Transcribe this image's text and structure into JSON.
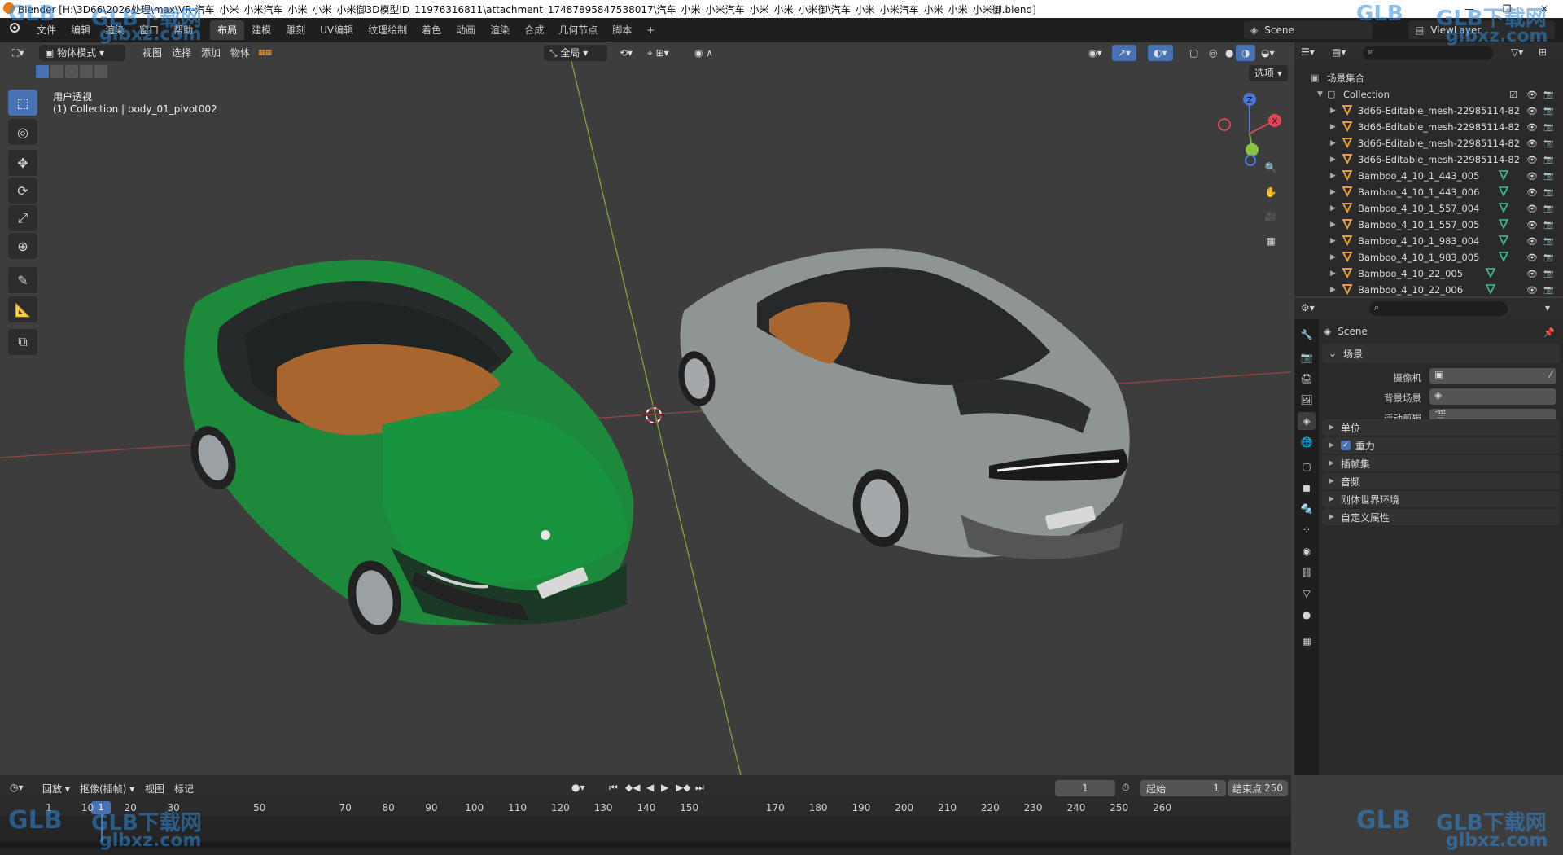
{
  "window": {
    "title": "Blender [H:\\3D66\\2026处理\\max\\VR-汽车_小米_小米汽车_小米_小米_小米御3D模型ID_11976316811\\attachment_17487895847538017\\汽车_小米_小米汽车_小米_小米_小米御\\汽车_小米_小米汽车_小米_小米_小米御.blend]",
    "controls": [
      "—",
      "❐",
      "✕"
    ]
  },
  "menubar": {
    "menus": [
      "文件",
      "编辑",
      "渲染",
      "窗口",
      "帮助"
    ],
    "tabs": [
      "布局",
      "建模",
      "雕刻",
      "UV编辑",
      "纹理绘制",
      "着色",
      "动画",
      "渲染",
      "合成",
      "几何节点",
      "脚本"
    ],
    "active_tab": "布局",
    "add_tab": "+",
    "scene": "Scene",
    "view_layer": "ViewLayer"
  },
  "viewport": {
    "mode": "物体模式",
    "menus": [
      "视图",
      "选择",
      "添加",
      "物体"
    ],
    "transform_orientation": "全局",
    "options": "选项",
    "overlay_title": "用户透视",
    "overlay_sub": "(1) Collection | body_01_pivot002",
    "gizmo_axes": [
      "Z",
      "X"
    ],
    "tools": [
      "select-box",
      "cursor",
      "move",
      "rotate",
      "scale",
      "transform",
      "annotate",
      "measure",
      "add-cube"
    ]
  },
  "outliner": {
    "root": "场景集合",
    "collection": "Collection",
    "items": [
      {
        "name": "3d66-Editable_mesh-22985114-82",
        "extra": false
      },
      {
        "name": "3d66-Editable_mesh-22985114-82",
        "extra": false
      },
      {
        "name": "3d66-Editable_mesh-22985114-82",
        "extra": false
      },
      {
        "name": "3d66-Editable_mesh-22985114-82",
        "extra": false
      },
      {
        "name": "Bamboo_4_10_1_443_005",
        "extra": true
      },
      {
        "name": "Bamboo_4_10_1_443_006",
        "extra": true
      },
      {
        "name": "Bamboo_4_10_1_557_004",
        "extra": true
      },
      {
        "name": "Bamboo_4_10_1_557_005",
        "extra": true
      },
      {
        "name": "Bamboo_4_10_1_983_004",
        "extra": true
      },
      {
        "name": "Bamboo_4_10_1_983_005",
        "extra": true
      },
      {
        "name": "Bamboo_4_10_22_005",
        "extra": true
      },
      {
        "name": "Bamboo_4_10_22_006",
        "extra": true
      }
    ]
  },
  "properties": {
    "context": "Scene",
    "scene_section": "场景",
    "camera_label": "摄像机",
    "background_label": "背景场景",
    "active_clip_label": "活动剪辑",
    "sections": [
      "单位",
      "重力",
      "插帧集",
      "音频",
      "刚体世界环境",
      "自定义属性"
    ],
    "gravity_checked": true
  },
  "timeline": {
    "menus": [
      "回放",
      "抠像(插帧)",
      "视图",
      "标记"
    ],
    "current_frame": "1",
    "start_label": "起始",
    "start": "1",
    "end_label": "结束点",
    "end": "250",
    "ruler": [
      "1",
      "10",
      "20",
      "30",
      "50",
      "70",
      "80",
      "90",
      "100",
      "110",
      "120",
      "130",
      "140",
      "150",
      "170",
      "180",
      "190",
      "200",
      "210",
      "220",
      "230",
      "240",
      "250",
      "260"
    ]
  },
  "watermark": {
    "brand": "GLB下载网",
    "site": "glbxz.com",
    "brand_short": "GLB"
  },
  "colors": {
    "accent": "#4772b3",
    "car_green": "#1f8f3e",
    "car_silver": "#8f9495",
    "axis_x": "#c04a4a",
    "axis_y": "#8fbf3a"
  }
}
